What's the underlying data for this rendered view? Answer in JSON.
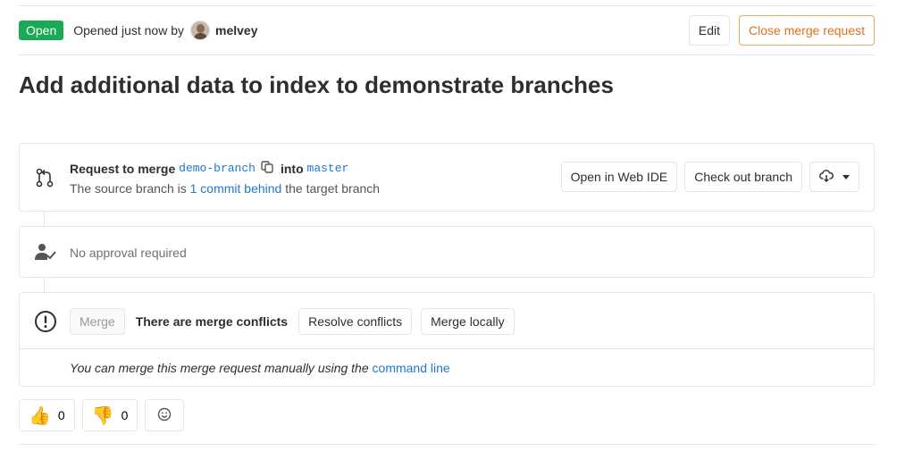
{
  "header": {
    "status": "Open",
    "opened_text": "Opened just now by",
    "author": "melvey",
    "edit_label": "Edit",
    "close_label": "Close merge request"
  },
  "title": "Add additional data to index to demonstrate branches",
  "merge_info": {
    "request_to_merge": "Request to merge",
    "source_branch": "demo-branch",
    "into": "into",
    "target_branch": "master",
    "source_prefix": "The source branch is",
    "commits_behind": "1 commit behind",
    "source_suffix": "the target branch",
    "open_web_ide": "Open in Web IDE",
    "check_out_branch": "Check out branch"
  },
  "approval": {
    "text": "No approval required"
  },
  "merge": {
    "merge_label": "Merge",
    "conflict_text": "There are merge conflicts",
    "resolve_label": "Resolve conflicts",
    "merge_locally_label": "Merge locally",
    "manual_text": "You can merge this merge request manually using the",
    "command_line": "command line"
  },
  "awards": {
    "thumbsup_emoji": "👍",
    "thumbsup_count": "0",
    "thumbsdown_emoji": "👎",
    "thumbsdown_count": "0"
  },
  "colors": {
    "open_badge": "#1aaa55",
    "link": "#1f78d1",
    "warning": "#e0701d"
  }
}
